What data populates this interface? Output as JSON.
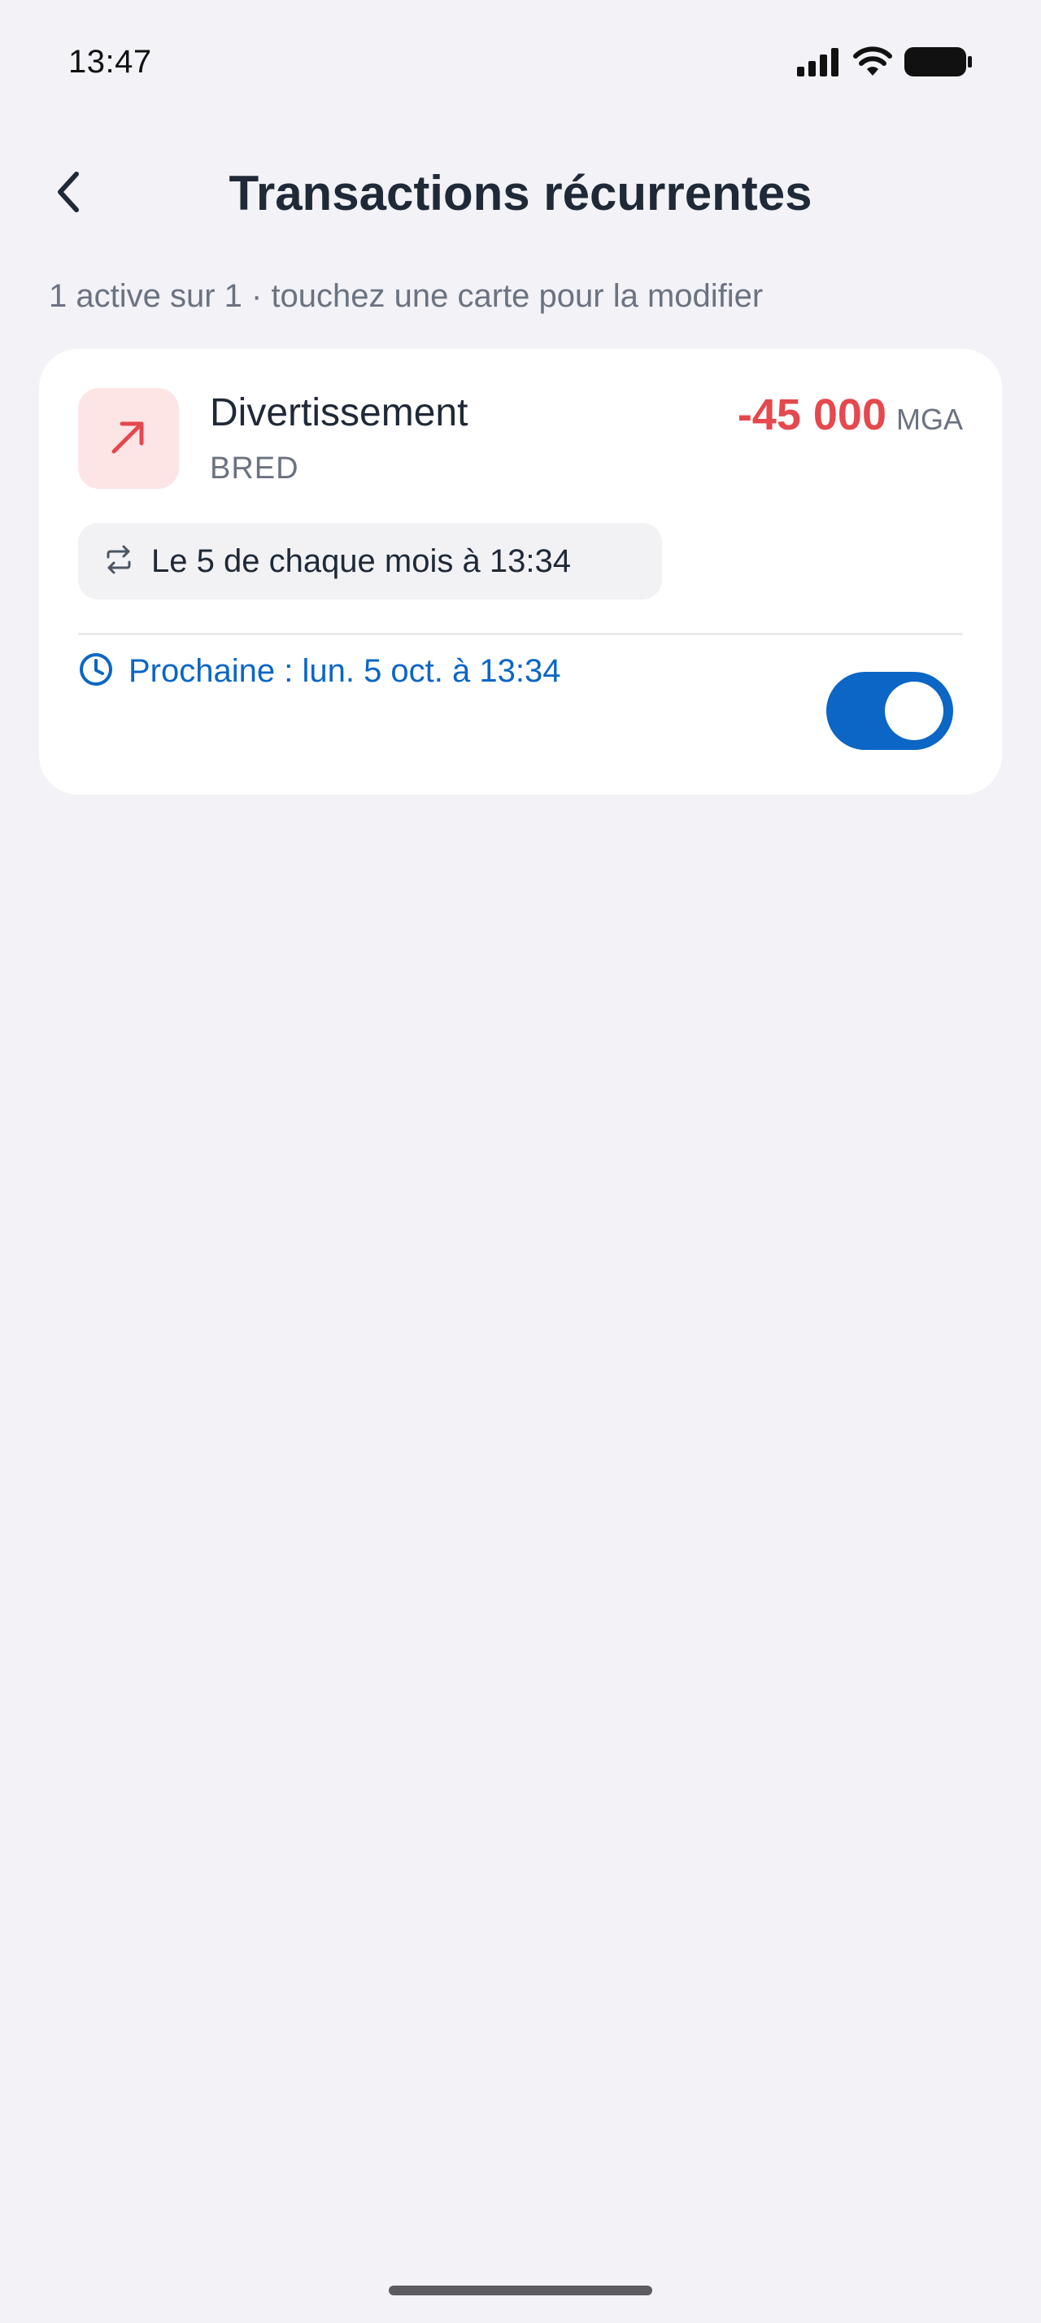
{
  "status_bar": {
    "time": "13:47",
    "icons": [
      "cellular-signal-icon",
      "wifi-icon",
      "battery-icon"
    ]
  },
  "header": {
    "title": "Transactions récurrentes",
    "back_icon": "chevron-left-icon"
  },
  "subtitle": "1 active sur 1 · touchez une carte pour la modifier",
  "recurring": [
    {
      "category": "Divertissement",
      "account": "BRED",
      "amount": "-45 000",
      "currency": "MGA",
      "category_icon": "arrow-up-right-icon",
      "schedule_icon": "repeat-icon",
      "schedule": "Le 5 de chaque mois à 13:34",
      "next_icon": "clock-icon",
      "next": "Prochaine : lun. 5 oct. à 13:34",
      "enabled": true
    }
  ],
  "colors": {
    "background": "#f2f2f7",
    "card": "#ffffff",
    "expense": "#e5484d",
    "expense_bg": "#fde5e6",
    "accent": "#0b66c6",
    "text_primary": "#1f2937",
    "text_secondary": "#6b7280"
  }
}
